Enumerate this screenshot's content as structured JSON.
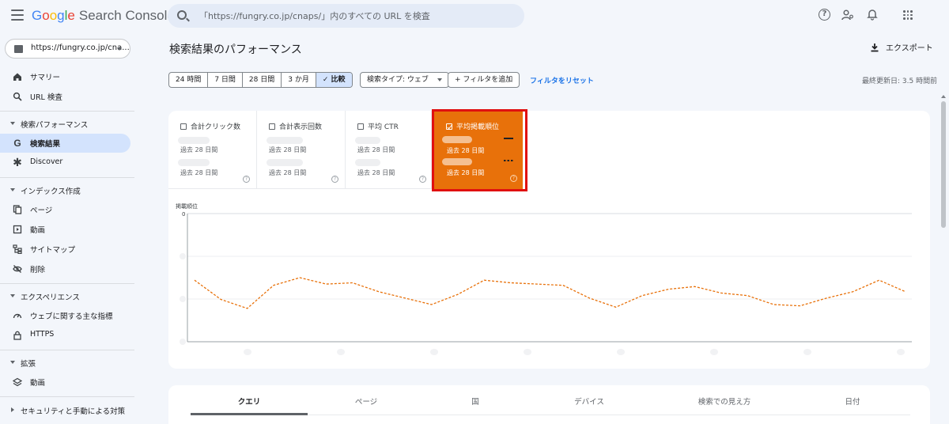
{
  "topbar": {
    "logo_letters": [
      "G",
      "o",
      "o",
      "g",
      "l",
      "e"
    ],
    "product": "Search Console",
    "search_placeholder": "「https://fungry.co.jp/cnaps/」内のすべての URL を検査",
    "icons": [
      "menu-icon",
      "search-icon",
      "help-icon",
      "manage-users-icon",
      "notifications-icon",
      "apps-icon"
    ]
  },
  "sidebar": {
    "property": "https://fungry.co.jp/cna...",
    "top_items": [
      {
        "label": "サマリー",
        "icon": "home-icon"
      },
      {
        "label": "URL 検査",
        "icon": "search-icon"
      }
    ],
    "sections": [
      {
        "label": "検索パフォーマンス",
        "items": [
          {
            "label": "検索結果",
            "icon": "google-g-icon",
            "active": true
          },
          {
            "label": "Discover",
            "icon": "asterisk-icon"
          }
        ]
      },
      {
        "label": "インデックス作成",
        "items": [
          {
            "label": "ページ",
            "icon": "pages-icon"
          },
          {
            "label": "動画",
            "icon": "video-icon"
          },
          {
            "label": "サイトマップ",
            "icon": "sitemap-icon"
          },
          {
            "label": "削除",
            "icon": "eye-off-icon"
          }
        ]
      },
      {
        "label": "エクスペリエンス",
        "items": [
          {
            "label": "ウェブに関する主な指標",
            "icon": "gauge-icon"
          },
          {
            "label": "HTTPS",
            "icon": "lock-icon"
          }
        ]
      },
      {
        "label": "拡張",
        "items": [
          {
            "label": "動画",
            "icon": "layers-icon"
          }
        ]
      },
      {
        "label": "セキュリティと手動による対策",
        "collapsed": true,
        "items": []
      }
    ]
  },
  "main": {
    "title": "検索結果のパフォーマンス",
    "export_label": "エクスポート",
    "date_ranges": [
      "24 時間",
      "7 日間",
      "28 日間",
      "3 か月",
      "比較"
    ],
    "compare_check": "✓",
    "search_type_chip": "検索タイプ: ウェブ",
    "add_filter_chip": "+ フィルタを追加",
    "reset_filters": "フィルタをリセット",
    "last_updated": "最終更新日: 3.5 時間前"
  },
  "metrics": [
    {
      "label": "合計クリック数",
      "period1": "過去 28 日間",
      "period2": "過去 28 日間",
      "checked": false
    },
    {
      "label": "合計表示回数",
      "period1": "過去 28 日間",
      "period2": "過去 28 日間",
      "checked": false
    },
    {
      "label": "平均 CTR",
      "period1": "過去 28 日間",
      "period2": "過去 28 日間",
      "checked": false
    },
    {
      "label": "平均掲載順位",
      "period1": "過去 28 日間",
      "period2": "過去 28 日間",
      "checked": true
    }
  ],
  "colors": {
    "selected_metric": "#e8710a",
    "highlight_box": "#e01010",
    "link": "#1a73e8",
    "active_nav": "#d3e3fd"
  },
  "chart_data": {
    "type": "line",
    "ylabel": "掲載順位",
    "y_tick_top": "0",
    "series": [
      {
        "values": [
          0.52,
          0.67,
          0.74,
          0.56,
          0.5,
          0.55,
          0.54,
          0.61,
          0.66,
          0.71,
          0.63,
          0.52,
          0.54,
          0.55,
          0.56,
          0.66,
          0.73,
          0.64,
          0.59,
          0.57,
          0.62,
          0.64,
          0.71,
          0.72,
          0.66,
          0.61,
          0.52,
          0.61
        ]
      }
    ],
    "grid": true
  },
  "bottom_tabs": [
    "クエリ",
    "ページ",
    "国",
    "デバイス",
    "検索での見え方",
    "日付"
  ]
}
